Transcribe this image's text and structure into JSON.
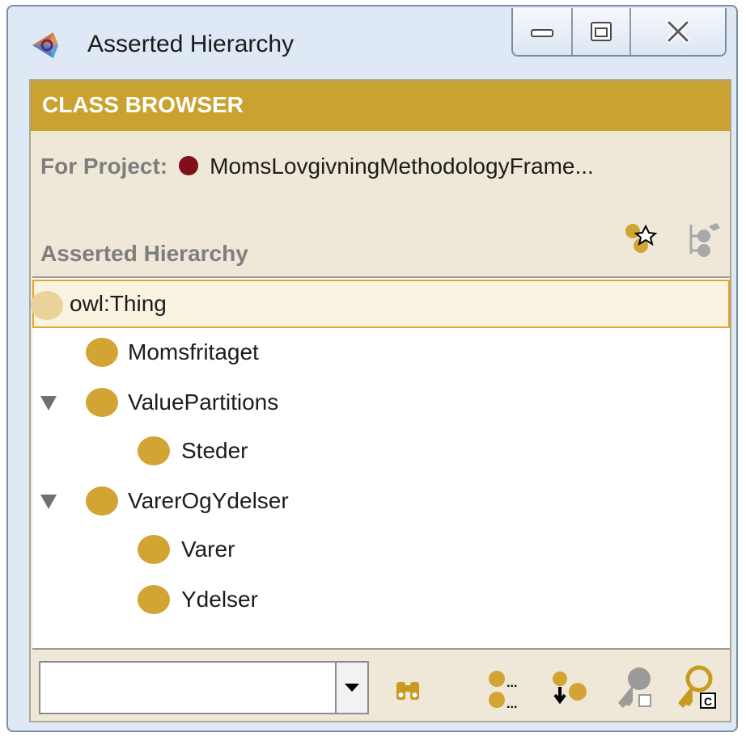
{
  "window": {
    "title": "Asserted Hierarchy",
    "app_icon": "protege-icon",
    "controls": [
      "minimize-icon",
      "maximize-icon",
      "close-icon"
    ]
  },
  "panel": {
    "header": "CLASS BROWSER",
    "project_label": "For Project:",
    "project_name": "MomsLovgivningMethodologyFrame...",
    "project_dot_color": "#7e0f1b",
    "hierarchy_label": "Asserted Hierarchy",
    "header_color": "#caa232",
    "node_color": "#d2a433"
  },
  "tree": {
    "items": [
      {
        "label": "owl:Thing",
        "depth": 0,
        "selected": true,
        "expandable": false
      },
      {
        "label": "Momsfritaget",
        "depth": 1,
        "selected": false,
        "expandable": false
      },
      {
        "label": "ValuePartitions",
        "depth": 1,
        "selected": false,
        "expandable": true,
        "expanded": true
      },
      {
        "label": "Steder",
        "depth": 2,
        "selected": false,
        "expandable": false
      },
      {
        "label": "VarerOgYdelser",
        "depth": 1,
        "selected": false,
        "expandable": true,
        "expanded": true
      },
      {
        "label": "Varer",
        "depth": 2,
        "selected": false,
        "expandable": false
      },
      {
        "label": "Ydelser",
        "depth": 2,
        "selected": false,
        "expandable": false
      }
    ]
  },
  "search": {
    "value": ""
  },
  "toolbar_icons": [
    "create-subclass-icon",
    "create-superclass-icon",
    "find-icon",
    "add-class-list-icon",
    "move-class-icon",
    "key-icon",
    "key-c-icon"
  ]
}
